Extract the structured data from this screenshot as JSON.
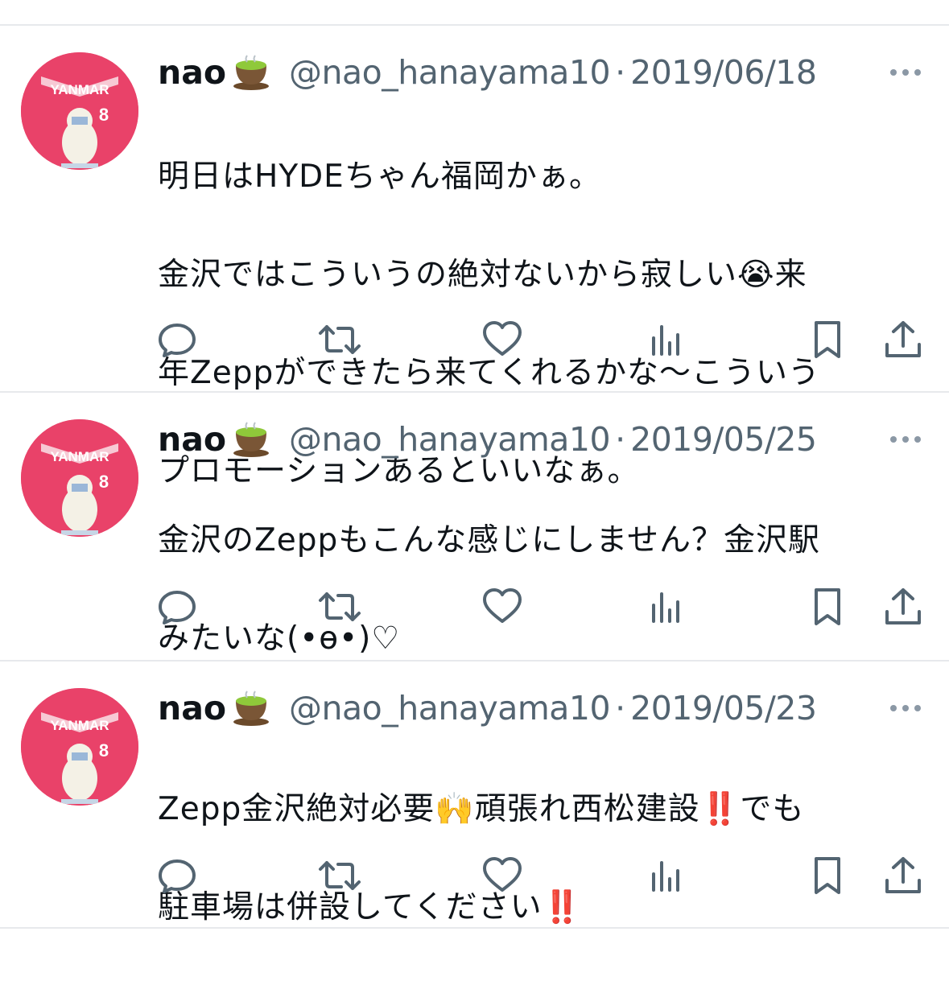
{
  "tweets": [
    {
      "name": "nao",
      "handle": "@nao_hanayama10",
      "separator": "·",
      "date": "2019/06/18",
      "text_lines": [
        "明日はHYDEちゃん福岡かぁ。",
        "金沢ではこういうの絶対ないから寂しい😭来",
        "年Zeppができたら来てくれるかな〜こういう",
        "プロモーションあるといいなぁ。"
      ]
    },
    {
      "name": "nao",
      "handle": "@nao_hanayama10",
      "separator": "·",
      "date": "2019/05/25",
      "text_lines": [
        "金沢のZeppもこんな感じにしません？金沢駅",
        "みたいな(•ө•)♡"
      ]
    },
    {
      "name": "nao",
      "handle": "@nao_hanayama10",
      "separator": "·",
      "date": "2019/05/23",
      "text_lines": [
        "Zepp金沢絶対必要🙌頑張れ西松建設‼️でも",
        "駐車場は併設してください‼️"
      ]
    }
  ],
  "avatar": {
    "jersey_text": "YANMAR",
    "jersey_number": "8"
  },
  "icons": [
    "more-icon",
    "reply-icon",
    "retweet-icon",
    "like-icon",
    "views-icon",
    "bookmark-icon",
    "share-icon"
  ],
  "colors": {
    "text": "#0f1419",
    "secondary": "#536471",
    "divider": "#e7e9ec",
    "avatar_bg": "#e94269"
  }
}
